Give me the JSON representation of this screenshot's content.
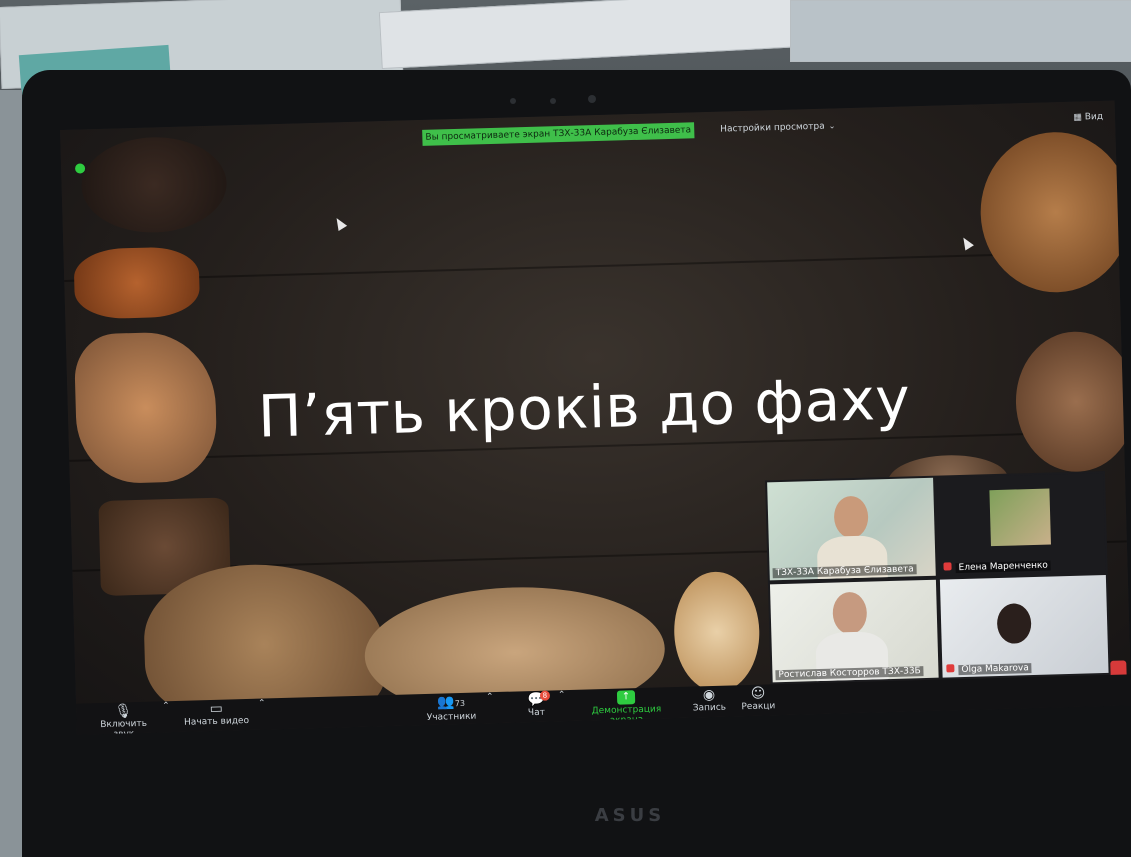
{
  "zoom": {
    "banner_text": "Вы просматриваете экран ТЗХ-33А Карабуза Єлизавета",
    "view_options_label": "Настройки просмотра",
    "view_button_label": "Вид"
  },
  "slide": {
    "title": "П’ять кроків до фаху"
  },
  "gallery": {
    "participants": [
      {
        "name": "ТЗХ-33А Карабуза Єлизавета",
        "muted": false
      },
      {
        "name": "Елена Маренченко",
        "muted": true
      },
      {
        "name": "Ростислав Косторров ТЗХ-33Б",
        "muted": false
      },
      {
        "name": "Olga Makarova",
        "muted": true
      }
    ]
  },
  "toolbar": {
    "unmute_label": "Включить звук",
    "start_video_label": "Начать видео",
    "participants_label": "Участники",
    "participants_count": "73",
    "chat_label": "Чат",
    "chat_badge": "8",
    "share_label": "Демонстрация экрана",
    "record_label": "Запись",
    "reactions_label": "Реакци"
  },
  "laptop": {
    "brand": "ASUS"
  },
  "colors": {
    "banner_green": "#3fbf4a",
    "share_green": "#2ecc40",
    "toolbar_bg": "#121214",
    "mute_red": "#e03b3b"
  }
}
